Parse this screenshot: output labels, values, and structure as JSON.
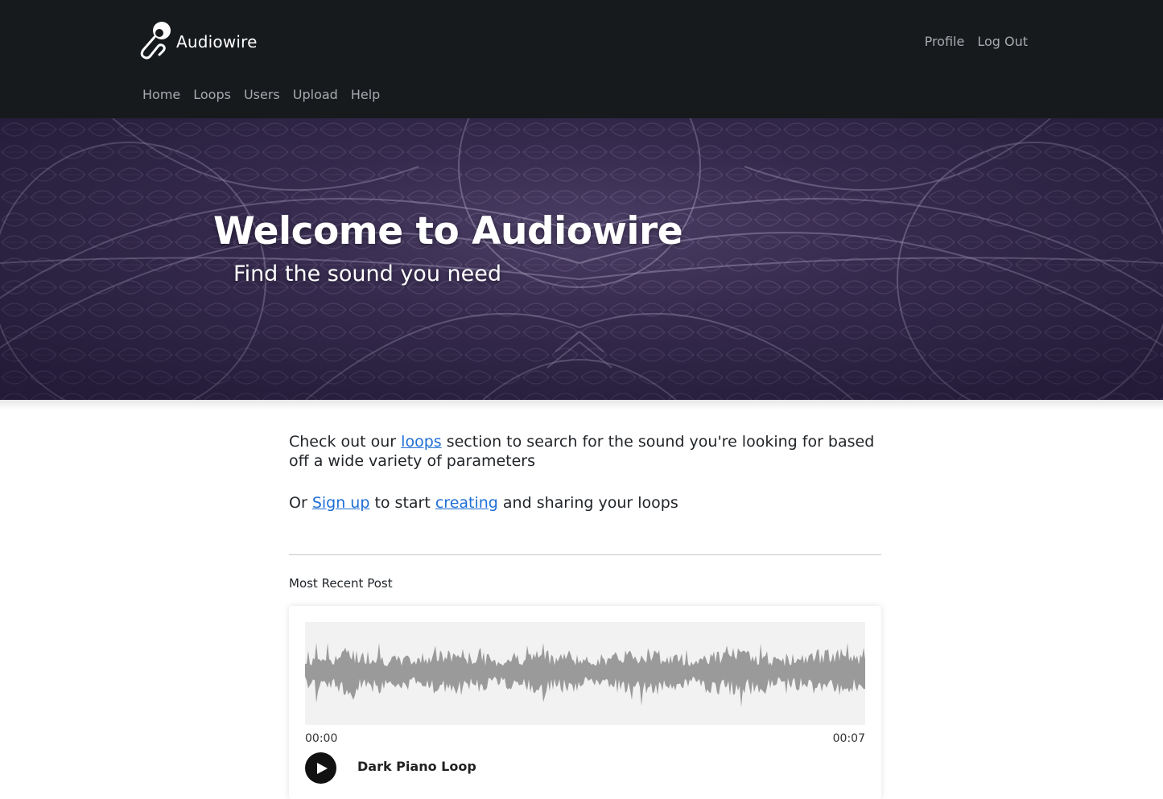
{
  "brand": {
    "name": "Audiowire"
  },
  "nav": {
    "right": [
      {
        "label": "Profile"
      },
      {
        "label": "Log Out"
      }
    ],
    "left": [
      {
        "label": "Home"
      },
      {
        "label": "Loops"
      },
      {
        "label": "Users"
      },
      {
        "label": "Upload"
      },
      {
        "label": "Help"
      }
    ]
  },
  "hero": {
    "title": "Welcome to Audiowire",
    "subtitle": "Find the sound you need"
  },
  "intro": {
    "p1_before": "Check out our ",
    "p1_link": "loops",
    "p1_after": " section to search for the sound you're looking for based off a wide variety of parameters",
    "p2_before": "Or ",
    "p2_link1": "Sign up",
    "p2_middle": " to start ",
    "p2_link2": "creating",
    "p2_after": " and sharing your loops"
  },
  "recent": {
    "label": "Most Recent Post",
    "player": {
      "time_start": "00:00",
      "time_end": "00:07",
      "title": "Dark Piano Loop"
    }
  },
  "colors": {
    "navbar": "#171a1d",
    "link": "#1e6fd6",
    "waveform": "#9a9a9a"
  }
}
